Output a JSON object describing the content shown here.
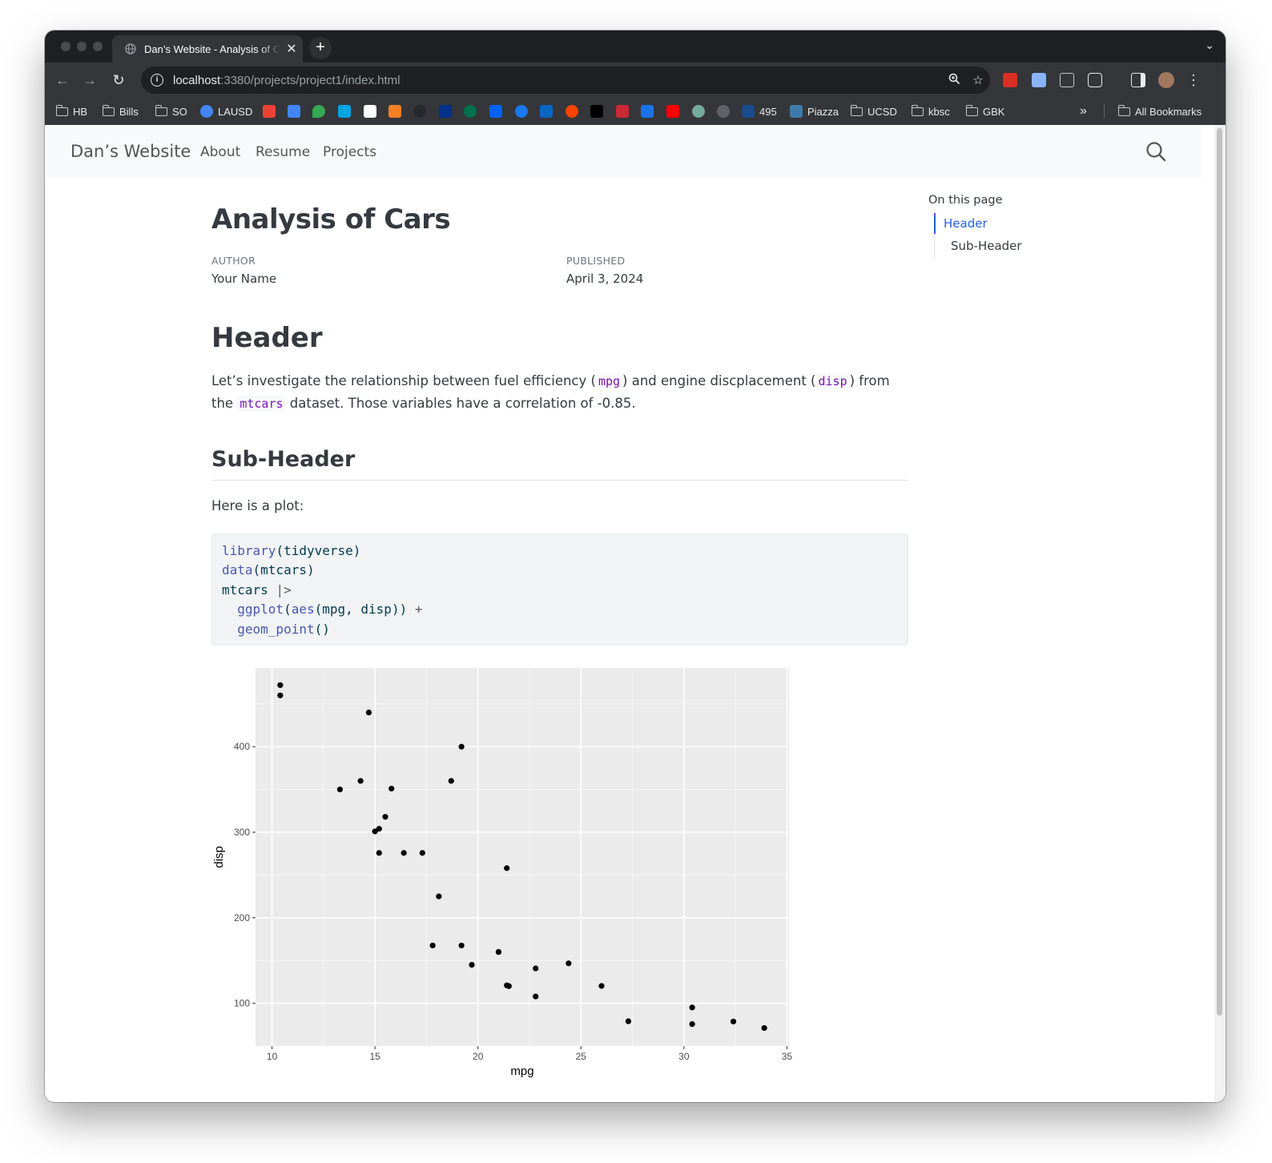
{
  "browser": {
    "tab_title": "Dan’s Website - Analysis of Cars",
    "url_host": "localhost",
    "url_path": ":3380/projects/project1/index.html",
    "bookmarks": [
      "HB",
      "Bills",
      "SO",
      "LAUSD",
      "495",
      "Piazza",
      "UCSD",
      "kbsc",
      "GBK"
    ],
    "all_bookmarks": "All Bookmarks",
    "overflow": "»"
  },
  "site": {
    "brand": "Dan’s Website",
    "nav": [
      "About",
      "Resume",
      "Projects"
    ]
  },
  "article": {
    "title": "Analysis of Cars",
    "author_label": "AUTHOR",
    "author": "Your Name",
    "published_label": "PUBLISHED",
    "published": "April 3, 2024",
    "header": "Header",
    "para_part1": "Let’s investigate the relationship between fuel efficiency (",
    "code_mpg": "mpg",
    "para_part2": ") and engine discplacement (",
    "code_disp": "disp",
    "para_part3": ") from the ",
    "code_mtcars": "mtcars",
    "para_part4": " dataset. Those variables have a correlation of -0.85.",
    "subheader": "Sub-Header",
    "plot_intro": "Here is a plot:",
    "code_lines": [
      "library(tidyverse)",
      "data(mtcars)",
      "mtcars |>",
      "  ggplot(aes(mpg, disp)) +",
      "  geom_point()"
    ]
  },
  "toc": {
    "title": "On this page",
    "items": [
      "Header",
      "Sub-Header"
    ]
  },
  "colors": {
    "link_active": "#2761e3",
    "code_inline": "#7d12ba",
    "plot_panel": "#ebebeb"
  },
  "chart_data": {
    "type": "scatter",
    "title": "",
    "xlabel": "mpg",
    "ylabel": "disp",
    "xlim": [
      9.2,
      35.1
    ],
    "ylim": [
      50,
      492
    ],
    "xticks": [
      10,
      15,
      20,
      25,
      30,
      35
    ],
    "yticks": [
      100,
      200,
      300,
      400
    ],
    "grid": true,
    "points": [
      [
        21.0,
        160
      ],
      [
        21.0,
        160
      ],
      [
        22.8,
        108
      ],
      [
        21.4,
        258
      ],
      [
        18.7,
        360
      ],
      [
        18.1,
        225
      ],
      [
        14.3,
        360
      ],
      [
        24.4,
        146.7
      ],
      [
        22.8,
        140.8
      ],
      [
        19.2,
        167.6
      ],
      [
        17.8,
        167.6
      ],
      [
        16.4,
        275.8
      ],
      [
        17.3,
        275.8
      ],
      [
        15.2,
        275.8
      ],
      [
        10.4,
        472
      ],
      [
        10.4,
        460
      ],
      [
        14.7,
        440
      ],
      [
        32.4,
        78.7
      ],
      [
        30.4,
        75.7
      ],
      [
        33.9,
        71.1
      ],
      [
        21.5,
        120.1
      ],
      [
        15.5,
        318
      ],
      [
        15.2,
        304
      ],
      [
        13.3,
        350
      ],
      [
        19.2,
        400
      ],
      [
        27.3,
        79
      ],
      [
        26.0,
        120.3
      ],
      [
        30.4,
        95.1
      ],
      [
        15.8,
        351
      ],
      [
        19.7,
        145
      ],
      [
        15.0,
        301
      ],
      [
        21.4,
        121
      ]
    ]
  }
}
